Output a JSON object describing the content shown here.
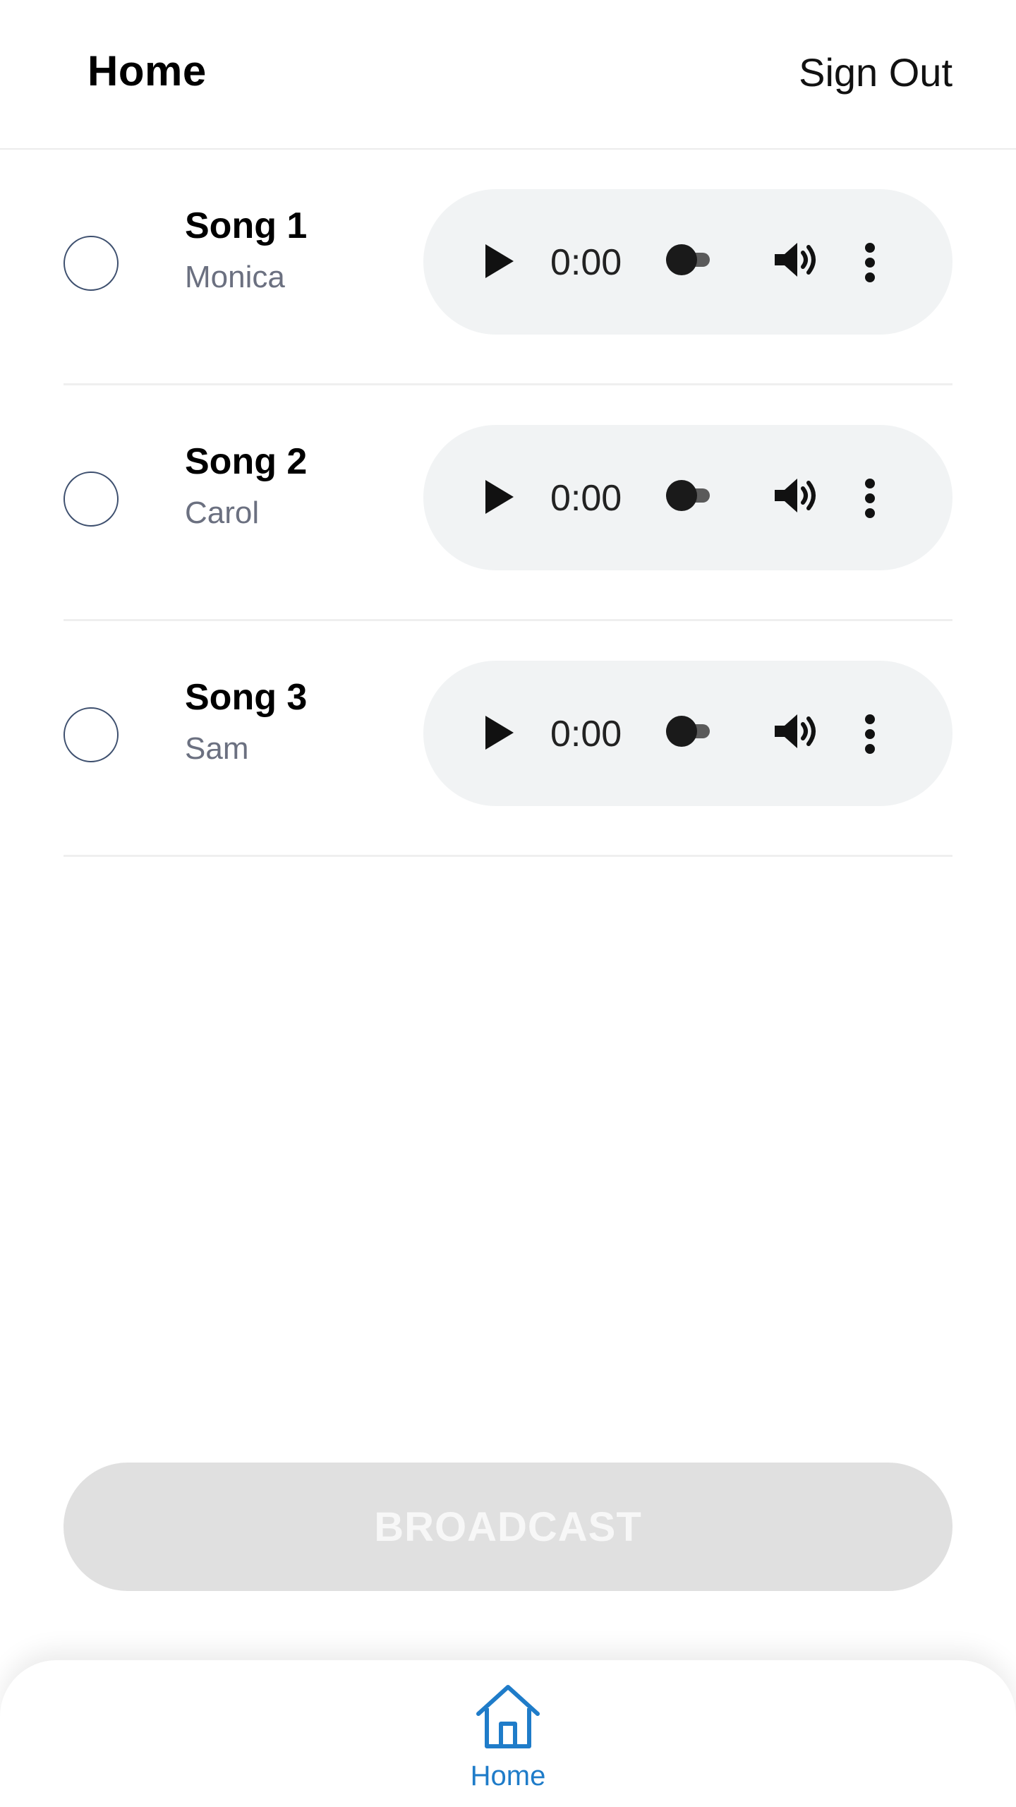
{
  "header": {
    "title": "Home",
    "sign_out_label": "Sign Out"
  },
  "songs": [
    {
      "title": "Song 1",
      "artist": "Monica",
      "time": "0:00",
      "selected": false
    },
    {
      "title": "Song 2",
      "artist": "Carol",
      "time": "0:00",
      "selected": false
    },
    {
      "title": "Song 3",
      "artist": "Sam",
      "time": "0:00",
      "selected": false
    }
  ],
  "broadcast": {
    "label": "BROADCAST",
    "disabled": true
  },
  "bottom_nav": {
    "items": [
      {
        "label": "Home",
        "icon": "home-icon",
        "active": true
      }
    ]
  },
  "colors": {
    "accent": "#1f7cc9",
    "player_bg": "#f1f3f4",
    "disabled_button_bg": "#e0e0e0",
    "divider": "#efefef"
  }
}
